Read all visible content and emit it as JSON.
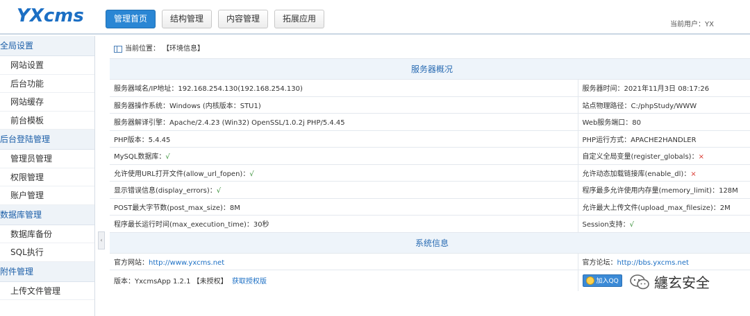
{
  "header": {
    "logo": "YXcms",
    "nav": [
      "管理首页",
      "结构管理",
      "内容管理",
      "拓展应用"
    ],
    "current_user": "当前用户：YX"
  },
  "sidebar": {
    "groups": [
      {
        "title": "全局设置",
        "items": [
          "网站设置",
          "后台功能",
          "网站缓存",
          "前台模板"
        ]
      },
      {
        "title": "后台登陆管理",
        "items": [
          "管理员管理",
          "权限管理",
          "账户管理"
        ]
      },
      {
        "title": "数据库管理",
        "items": [
          "数据库备份",
          "SQL执行"
        ]
      },
      {
        "title": "附件管理",
        "items": [
          "上传文件管理"
        ]
      }
    ]
  },
  "breadcrumb": {
    "label": "当前位置：",
    "value": "【环境信息】"
  },
  "server_section": {
    "title": "服务器概况",
    "rows": [
      {
        "left": "服务器域名/IP地址：192.168.254.130(192.168.254.130)",
        "right": "服务器时间：2021年11月3日 08:17:26"
      },
      {
        "left": "服务器操作系统：Windows (内核版本：STU1)",
        "right": "站点物理路径：C:/phpStudy/WWW"
      },
      {
        "left": "服务器解译引擎：Apache/2.4.23 (Win32) OpenSSL/1.0.2j PHP/5.4.45",
        "right": "Web服务端口：80"
      },
      {
        "left": "PHP版本：5.4.45",
        "right": "PHP运行方式：APACHE2HANDLER"
      },
      {
        "left": "MySQL数据库：",
        "left_mark": "√",
        "right": "自定义全局变量(register_globals)：",
        "right_mark": "×"
      },
      {
        "left": "允许使用URL打开文件(allow_url_fopen)：",
        "left_mark": "√",
        "right": "允许动态加载链接库(enable_dl)：",
        "right_mark": "×"
      },
      {
        "left": "显示错误信息(display_errors)：",
        "left_mark": "√",
        "right": "程序最多允许使用内存量(memory_limit)：128M"
      },
      {
        "left": "POST最大字节数(post_max_size)：8M",
        "right": "允许最大上传文件(upload_max_filesize)：2M"
      },
      {
        "left": "程序最长运行时间(max_execution_time)：30秒",
        "right": "Session支持：",
        "right_mark": "√"
      }
    ]
  },
  "system_section": {
    "title": "系统信息",
    "official_site_label": "官方网站：",
    "official_site_url": "http://www.yxcms.net",
    "forum_label": "官方论坛：",
    "forum_url": "http://bbs.yxcms.net",
    "version_label": "版本：YxcmsApp 1.2.1 【未授权】",
    "get_license": "获取授权版",
    "qq_button": "加入QQ"
  },
  "watermark": {
    "text": "纏玄安全"
  },
  "colors": {
    "accent": "#2a86d4",
    "link": "#1c6fc4",
    "ok": "#2e8b2e",
    "bad": "#d9342b"
  }
}
